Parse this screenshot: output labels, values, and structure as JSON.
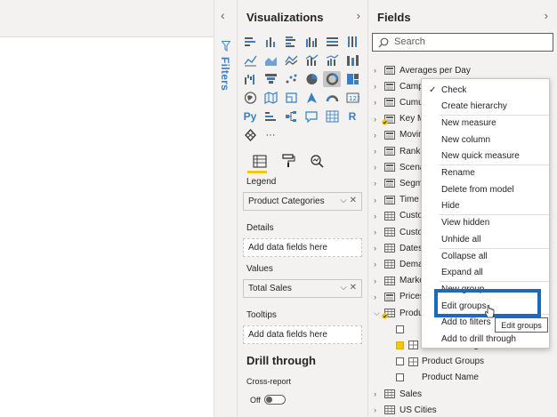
{
  "filters": {
    "label": "Filters"
  },
  "visualizations": {
    "title": "Visualizations",
    "icons": [
      "stacked-bar-icon",
      "stacked-column-icon",
      "clustered-bar-icon",
      "clustered-column-icon",
      "100-bar-icon",
      "100-column-icon",
      "line-icon",
      "area-icon",
      "stacked-area-icon",
      "line-column-icon",
      "line-clustered-column-icon",
      "ribbon-icon",
      "waterfall-icon",
      "funnel-icon",
      "scatter-icon",
      "pie-icon",
      "donut-icon",
      "treemap-icon",
      "map-icon",
      "filled-map-icon",
      "shape-map-icon",
      "azure-map-icon",
      "gauge-icon",
      "card-icon",
      "python-icon",
      "key-influencers-icon",
      "decomposition-tree-icon",
      "qa-icon",
      "table-icon",
      "r-script-icon",
      "smart-narrative-icon",
      "more-icon"
    ],
    "python_label": "Py",
    "r_label": "R",
    "more_label": "···",
    "wells": {
      "legend_label": "Legend",
      "legend_value": "Product Categories",
      "details_label": "Details",
      "details_placeholder": "Add data fields here",
      "values_label": "Values",
      "values_value": "Total Sales",
      "tooltips_label": "Tooltips",
      "tooltips_placeholder": "Add data fields here"
    },
    "drill_through": {
      "title": "Drill through",
      "cross_report_label": "Cross-report",
      "toggle_state": "Off"
    }
  },
  "fields": {
    "title": "Fields",
    "search_placeholder": "Search",
    "tables": [
      {
        "name": "Averages per Day",
        "kind": "calc"
      },
      {
        "name": "Camp",
        "kind": "calc"
      },
      {
        "name": "Cumu",
        "kind": "calc"
      },
      {
        "name": "Key M",
        "kind": "calc-check"
      },
      {
        "name": "Movin",
        "kind": "calc"
      },
      {
        "name": "Rankin",
        "kind": "calc"
      },
      {
        "name": "Scena",
        "kind": "calc"
      },
      {
        "name": "Segm",
        "kind": "calc"
      },
      {
        "name": "Time (",
        "kind": "calc"
      },
      {
        "name": "Custo",
        "kind": "table"
      },
      {
        "name": "Custo",
        "kind": "table"
      },
      {
        "name": "Dates",
        "kind": "table"
      },
      {
        "name": "Dema",
        "kind": "table"
      },
      {
        "name": "Marke",
        "kind": "table"
      },
      {
        "name": "Prices",
        "kind": "calc"
      },
      {
        "name": "Produ",
        "kind": "table-check"
      }
    ],
    "sub_items": [
      {
        "name": "",
        "checked": false
      },
      {
        "name": "Product Categories",
        "checked": true
      },
      {
        "name": "Product Groups",
        "checked": false
      },
      {
        "name": "Product Name",
        "checked": false
      }
    ],
    "after_tables": [
      {
        "name": "Sales"
      },
      {
        "name": "US Cities"
      }
    ]
  },
  "context_menu": {
    "items": [
      "Check",
      "Create hierarchy",
      "New measure",
      "New column",
      "New quick measure",
      "Rename",
      "Delete from model",
      "Hide",
      "View hidden",
      "Unhide all",
      "Collapse all",
      "Expand all",
      "New group",
      "Edit groups",
      "Add to filters",
      "Add to drill through"
    ],
    "checkmark": "✓"
  },
  "tooltip": {
    "text": "Edit groups"
  },
  "colors": {
    "accent_blue": "#1a6bc0",
    "yellow": "#f2c811",
    "pane_bg": "#f3f2f1"
  }
}
